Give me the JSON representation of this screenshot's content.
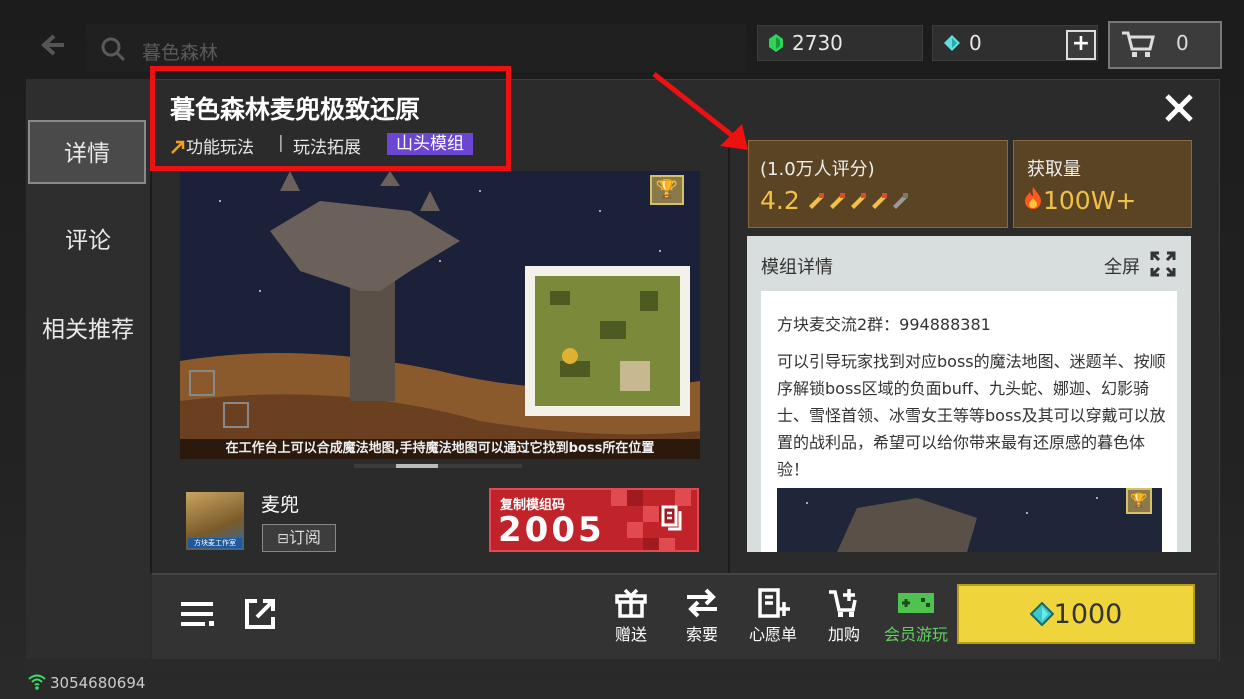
{
  "top": {
    "search_text": "暮色森林",
    "emerald": "2730",
    "diamond": "0",
    "plus": "+",
    "cart_count": "0"
  },
  "sidebar": {
    "items": [
      {
        "label": "详情"
      },
      {
        "label": "评论"
      },
      {
        "label": "相关推荐"
      }
    ]
  },
  "mod": {
    "title": "暮色森林麦兜极致还原",
    "tag1": "功能玩法",
    "sep": "|",
    "tag2": "玩法拓展",
    "tag3": "山头模组",
    "caption": "在工作台上可以合成魔法地图,手持魔法地图可以通过它找到boss所在位置"
  },
  "author": {
    "name": "麦兜",
    "subscribe": "订阅",
    "avatar_text": "方块麦工作室"
  },
  "code": {
    "label": "复制模组码",
    "value": "2005"
  },
  "rating": {
    "count": "(1.0万人评分)",
    "value": "4.2",
    "stars": 4.2,
    "get_label": "获取量",
    "get_value": "100W+"
  },
  "detail": {
    "title": "模组详情",
    "fullscreen": "全屏",
    "line1": "方块麦交流2群：994888381",
    "paragraph": "可以引导玩家找到对应boss的魔法地图、迷题羊、按顺序解锁boss区域的负面buff、九头蛇、娜迦、幻影骑士、雪怪首领、冰雪女王等等boss及其可以穿戴可以放置的战利品，希望可以给你带来最有还原感的暮色体验！"
  },
  "actions": {
    "gift": "赠送",
    "request": "索要",
    "wishlist": "心愿单",
    "add_cart": "加购",
    "member": "会员游玩",
    "price": "1000"
  },
  "status": {
    "device_id": "3054680694"
  },
  "colors": {
    "highlight_red": "#ee1111",
    "tag_purple": "#6b46d1",
    "buy_yellow": "#f0d43c",
    "rating_gold": "#f0c048",
    "member_green": "#5fd35f",
    "code_red": "#c1232a"
  }
}
